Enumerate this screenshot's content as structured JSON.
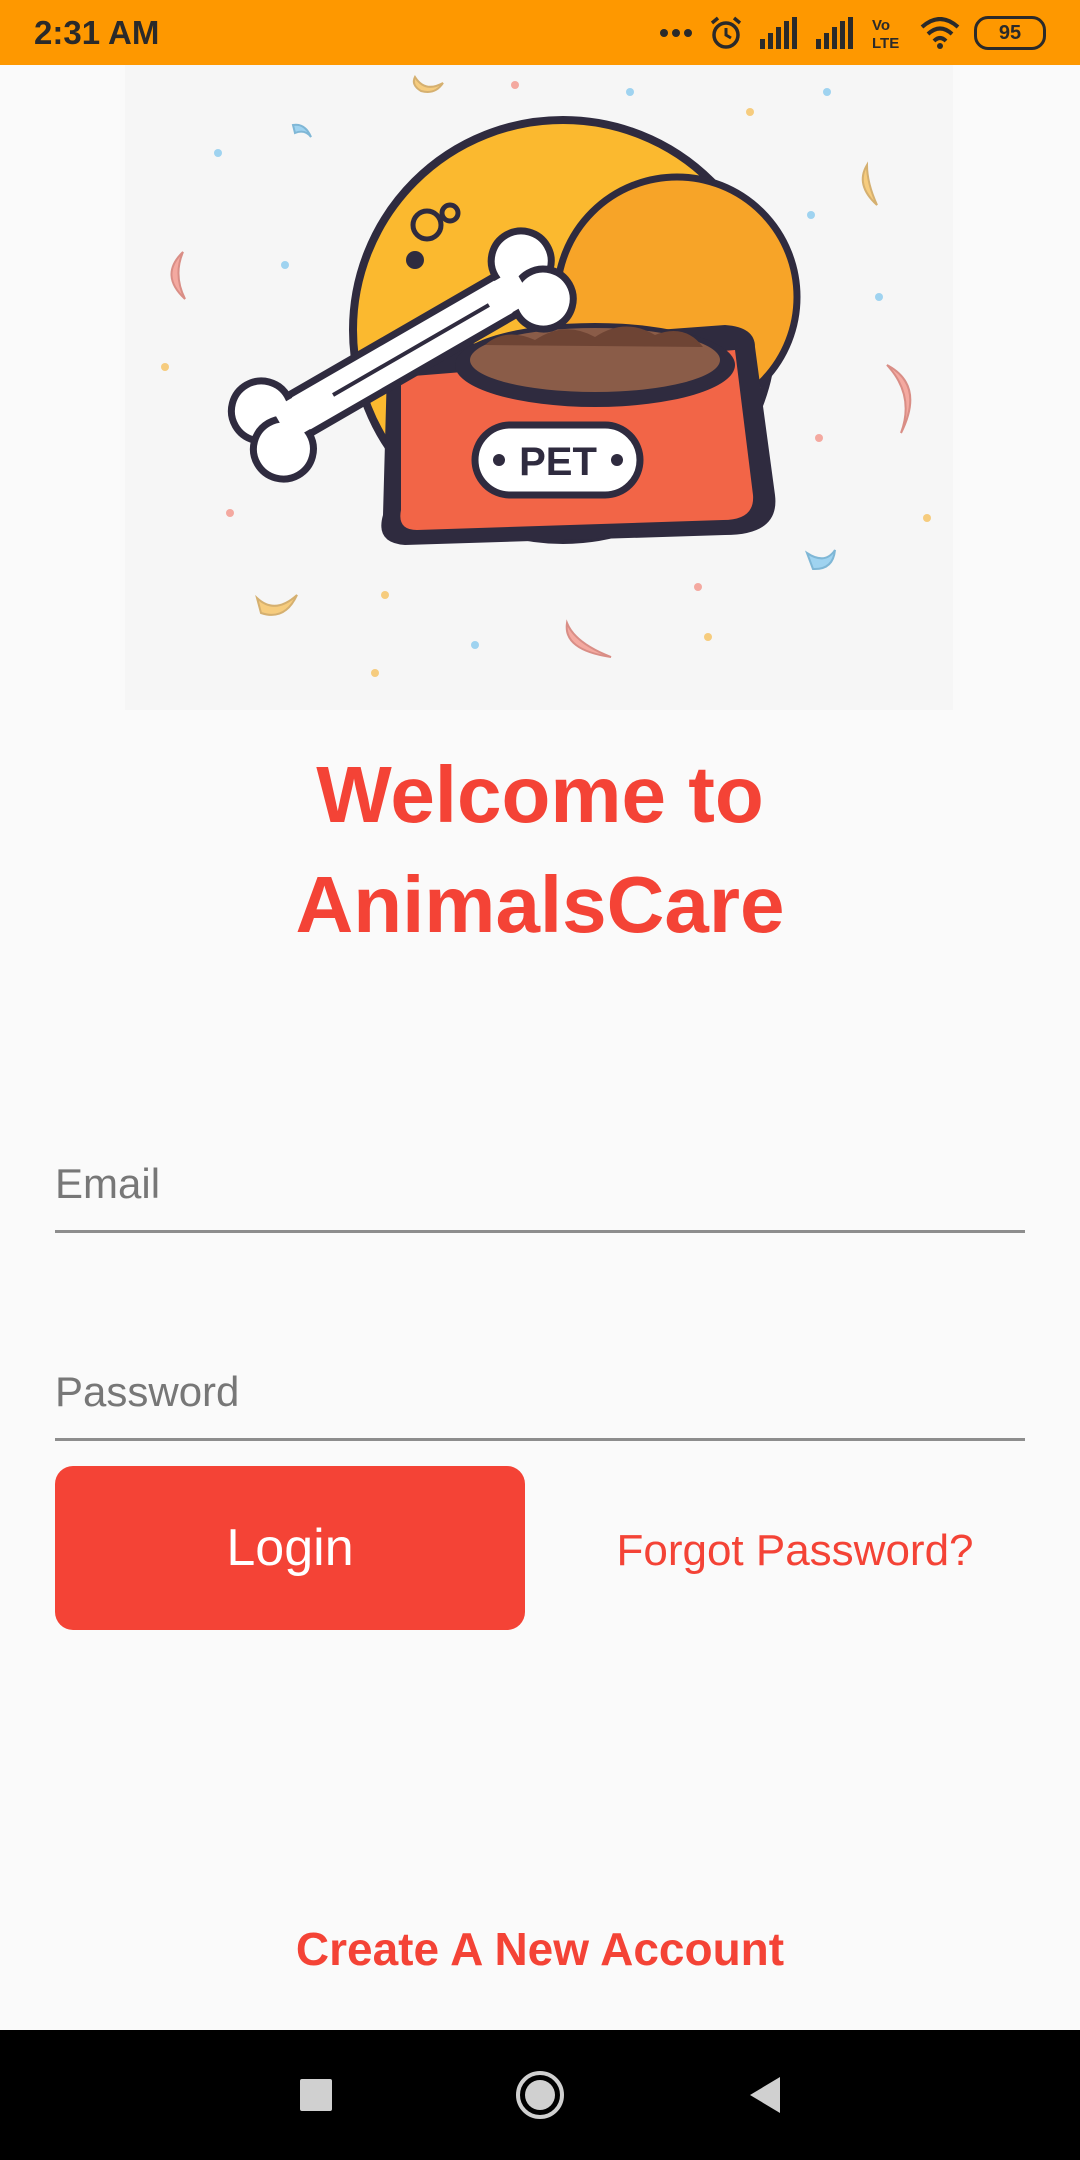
{
  "status_bar": {
    "time": "2:31 AM",
    "battery": "95",
    "icons": [
      "more-dots-icon",
      "alarm-icon",
      "signal-icon",
      "signal-icon",
      "volte-icon",
      "wifi-icon",
      "battery-icon"
    ],
    "volte_label": "Vo LTE",
    "background_color": "#fe9800"
  },
  "hero": {
    "image": "pet-food-bowl-with-bone-illustration",
    "bowl_label": "PET"
  },
  "welcome": {
    "line1": "Welcome to",
    "line2": "AnimalsCare",
    "color": "#f44336"
  },
  "form": {
    "email": {
      "placeholder": "Email",
      "value": ""
    },
    "password": {
      "placeholder": "Password",
      "value": ""
    },
    "login_label": "Login",
    "forgot_label": "Forgot Password?",
    "create_account_label": "Create A New Account"
  },
  "nav_bar": {
    "buttons": [
      "recent-apps-icon",
      "home-icon",
      "back-icon"
    ]
  }
}
